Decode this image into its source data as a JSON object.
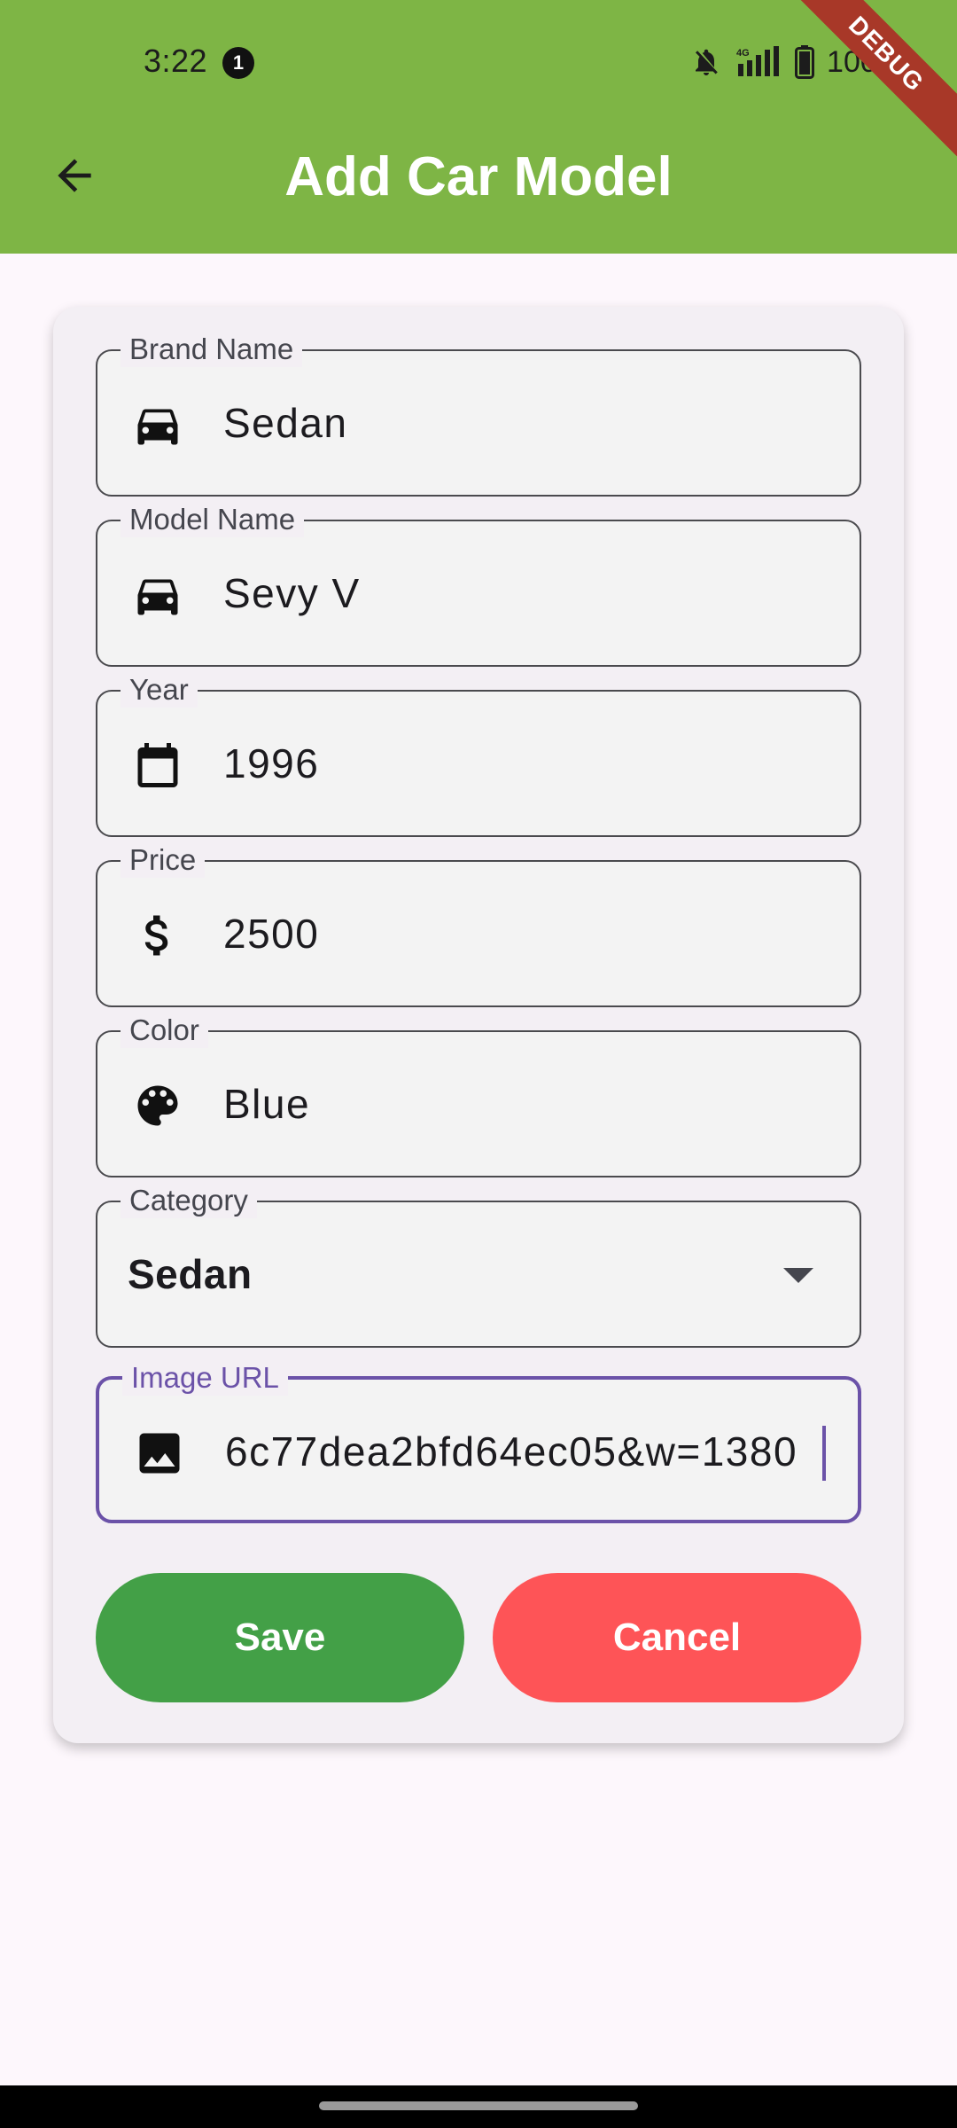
{
  "status_bar": {
    "time": "3:22",
    "notification_count": "1",
    "battery_percent": "100%"
  },
  "debug_banner": "DEBUG",
  "app_bar": {
    "title": "Add Car Model",
    "back_icon": "arrow-back-icon"
  },
  "form": {
    "brand": {
      "label": "Brand Name",
      "value": "Sedan",
      "icon": "car-icon"
    },
    "model": {
      "label": "Model Name",
      "value": "Sevy V",
      "icon": "car-icon"
    },
    "year": {
      "label": "Year",
      "value": "1996",
      "icon": "calendar-icon"
    },
    "price": {
      "label": "Price",
      "value": "2500",
      "icon": "dollar-icon"
    },
    "color": {
      "label": "Color",
      "value": "Blue",
      "icon": "palette-icon"
    },
    "category": {
      "label": "Category",
      "selected": "Sedan"
    },
    "image_url": {
      "label": "Image URL",
      "value": "6c77dea2bfd64ec05&w=1380",
      "icon": "image-icon",
      "focused": true
    }
  },
  "buttons": {
    "save_label": "Save",
    "cancel_label": "Cancel"
  },
  "colors": {
    "app_bar": "#7eb545",
    "save": "#43a047",
    "cancel": "#fe5457",
    "focus": "#6b52a8"
  }
}
